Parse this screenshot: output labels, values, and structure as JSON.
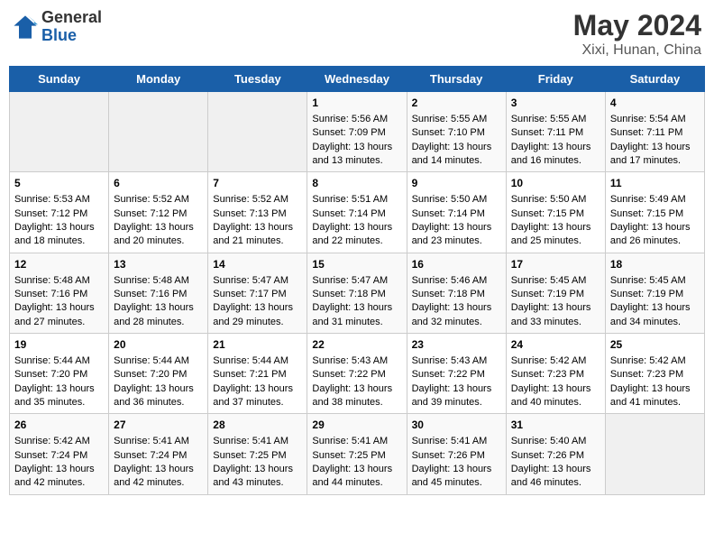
{
  "header": {
    "logo_general": "General",
    "logo_blue": "Blue",
    "title": "May 2024",
    "location": "Xixi, Hunan, China"
  },
  "weekdays": [
    "Sunday",
    "Monday",
    "Tuesday",
    "Wednesday",
    "Thursday",
    "Friday",
    "Saturday"
  ],
  "weeks": [
    [
      {
        "day": "",
        "sunrise": "",
        "sunset": "",
        "daylight": ""
      },
      {
        "day": "",
        "sunrise": "",
        "sunset": "",
        "daylight": ""
      },
      {
        "day": "",
        "sunrise": "",
        "sunset": "",
        "daylight": ""
      },
      {
        "day": "1",
        "sunrise": "Sunrise: 5:56 AM",
        "sunset": "Sunset: 7:09 PM",
        "daylight": "Daylight: 13 hours and 13 minutes."
      },
      {
        "day": "2",
        "sunrise": "Sunrise: 5:55 AM",
        "sunset": "Sunset: 7:10 PM",
        "daylight": "Daylight: 13 hours and 14 minutes."
      },
      {
        "day": "3",
        "sunrise": "Sunrise: 5:55 AM",
        "sunset": "Sunset: 7:11 PM",
        "daylight": "Daylight: 13 hours and 16 minutes."
      },
      {
        "day": "4",
        "sunrise": "Sunrise: 5:54 AM",
        "sunset": "Sunset: 7:11 PM",
        "daylight": "Daylight: 13 hours and 17 minutes."
      }
    ],
    [
      {
        "day": "5",
        "sunrise": "Sunrise: 5:53 AM",
        "sunset": "Sunset: 7:12 PM",
        "daylight": "Daylight: 13 hours and 18 minutes."
      },
      {
        "day": "6",
        "sunrise": "Sunrise: 5:52 AM",
        "sunset": "Sunset: 7:12 PM",
        "daylight": "Daylight: 13 hours and 20 minutes."
      },
      {
        "day": "7",
        "sunrise": "Sunrise: 5:52 AM",
        "sunset": "Sunset: 7:13 PM",
        "daylight": "Daylight: 13 hours and 21 minutes."
      },
      {
        "day": "8",
        "sunrise": "Sunrise: 5:51 AM",
        "sunset": "Sunset: 7:14 PM",
        "daylight": "Daylight: 13 hours and 22 minutes."
      },
      {
        "day": "9",
        "sunrise": "Sunrise: 5:50 AM",
        "sunset": "Sunset: 7:14 PM",
        "daylight": "Daylight: 13 hours and 23 minutes."
      },
      {
        "day": "10",
        "sunrise": "Sunrise: 5:50 AM",
        "sunset": "Sunset: 7:15 PM",
        "daylight": "Daylight: 13 hours and 25 minutes."
      },
      {
        "day": "11",
        "sunrise": "Sunrise: 5:49 AM",
        "sunset": "Sunset: 7:15 PM",
        "daylight": "Daylight: 13 hours and 26 minutes."
      }
    ],
    [
      {
        "day": "12",
        "sunrise": "Sunrise: 5:48 AM",
        "sunset": "Sunset: 7:16 PM",
        "daylight": "Daylight: 13 hours and 27 minutes."
      },
      {
        "day": "13",
        "sunrise": "Sunrise: 5:48 AM",
        "sunset": "Sunset: 7:16 PM",
        "daylight": "Daylight: 13 hours and 28 minutes."
      },
      {
        "day": "14",
        "sunrise": "Sunrise: 5:47 AM",
        "sunset": "Sunset: 7:17 PM",
        "daylight": "Daylight: 13 hours and 29 minutes."
      },
      {
        "day": "15",
        "sunrise": "Sunrise: 5:47 AM",
        "sunset": "Sunset: 7:18 PM",
        "daylight": "Daylight: 13 hours and 31 minutes."
      },
      {
        "day": "16",
        "sunrise": "Sunrise: 5:46 AM",
        "sunset": "Sunset: 7:18 PM",
        "daylight": "Daylight: 13 hours and 32 minutes."
      },
      {
        "day": "17",
        "sunrise": "Sunrise: 5:45 AM",
        "sunset": "Sunset: 7:19 PM",
        "daylight": "Daylight: 13 hours and 33 minutes."
      },
      {
        "day": "18",
        "sunrise": "Sunrise: 5:45 AM",
        "sunset": "Sunset: 7:19 PM",
        "daylight": "Daylight: 13 hours and 34 minutes."
      }
    ],
    [
      {
        "day": "19",
        "sunrise": "Sunrise: 5:44 AM",
        "sunset": "Sunset: 7:20 PM",
        "daylight": "Daylight: 13 hours and 35 minutes."
      },
      {
        "day": "20",
        "sunrise": "Sunrise: 5:44 AM",
        "sunset": "Sunset: 7:20 PM",
        "daylight": "Daylight: 13 hours and 36 minutes."
      },
      {
        "day": "21",
        "sunrise": "Sunrise: 5:44 AM",
        "sunset": "Sunset: 7:21 PM",
        "daylight": "Daylight: 13 hours and 37 minutes."
      },
      {
        "day": "22",
        "sunrise": "Sunrise: 5:43 AM",
        "sunset": "Sunset: 7:22 PM",
        "daylight": "Daylight: 13 hours and 38 minutes."
      },
      {
        "day": "23",
        "sunrise": "Sunrise: 5:43 AM",
        "sunset": "Sunset: 7:22 PM",
        "daylight": "Daylight: 13 hours and 39 minutes."
      },
      {
        "day": "24",
        "sunrise": "Sunrise: 5:42 AM",
        "sunset": "Sunset: 7:23 PM",
        "daylight": "Daylight: 13 hours and 40 minutes."
      },
      {
        "day": "25",
        "sunrise": "Sunrise: 5:42 AM",
        "sunset": "Sunset: 7:23 PM",
        "daylight": "Daylight: 13 hours and 41 minutes."
      }
    ],
    [
      {
        "day": "26",
        "sunrise": "Sunrise: 5:42 AM",
        "sunset": "Sunset: 7:24 PM",
        "daylight": "Daylight: 13 hours and 42 minutes."
      },
      {
        "day": "27",
        "sunrise": "Sunrise: 5:41 AM",
        "sunset": "Sunset: 7:24 PM",
        "daylight": "Daylight: 13 hours and 42 minutes."
      },
      {
        "day": "28",
        "sunrise": "Sunrise: 5:41 AM",
        "sunset": "Sunset: 7:25 PM",
        "daylight": "Daylight: 13 hours and 43 minutes."
      },
      {
        "day": "29",
        "sunrise": "Sunrise: 5:41 AM",
        "sunset": "Sunset: 7:25 PM",
        "daylight": "Daylight: 13 hours and 44 minutes."
      },
      {
        "day": "30",
        "sunrise": "Sunrise: 5:41 AM",
        "sunset": "Sunset: 7:26 PM",
        "daylight": "Daylight: 13 hours and 45 minutes."
      },
      {
        "day": "31",
        "sunrise": "Sunrise: 5:40 AM",
        "sunset": "Sunset: 7:26 PM",
        "daylight": "Daylight: 13 hours and 46 minutes."
      },
      {
        "day": "",
        "sunrise": "",
        "sunset": "",
        "daylight": ""
      }
    ]
  ]
}
